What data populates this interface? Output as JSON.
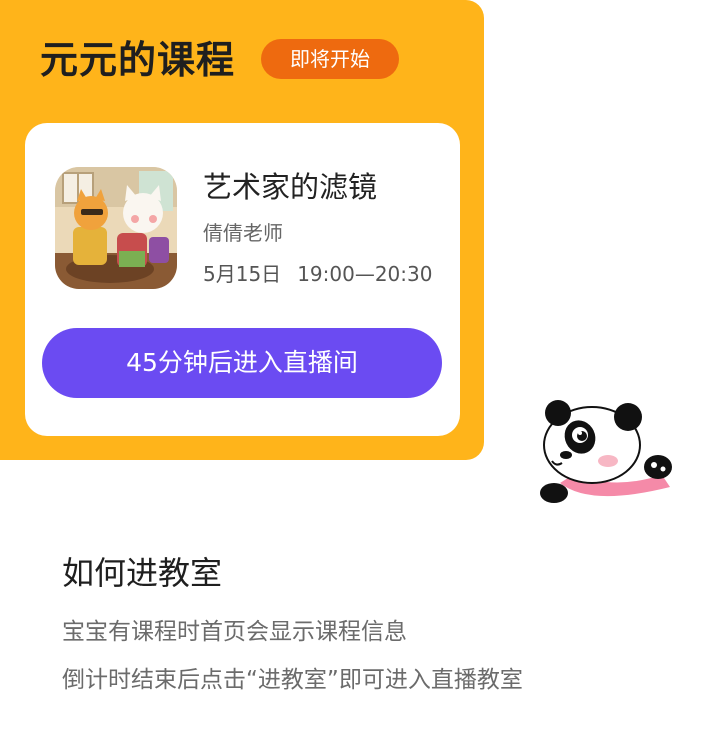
{
  "header": {
    "title": "元元的课程",
    "status_badge": "即将开始"
  },
  "course": {
    "name": "艺术家的滤镜",
    "teacher": "倩倩老师",
    "date": "5月15日",
    "time": "19:00—20:30",
    "enter_button_label": "45分钟后进入直播间",
    "thumbnail_icon": "cartoon-tiger-and-cat-illustration"
  },
  "mascot": {
    "icon": "panda-mascot-icon"
  },
  "help": {
    "title": "如何进教室",
    "lines": [
      "宝宝有课程时首页会显示课程信息",
      "倒计时结束后点击“进教室”即可进入直播教室"
    ]
  },
  "colors": {
    "panel": "#FFB41A",
    "badge": "#EE6A0F",
    "button": "#6B4BF2",
    "card": "#FFFFFF"
  }
}
